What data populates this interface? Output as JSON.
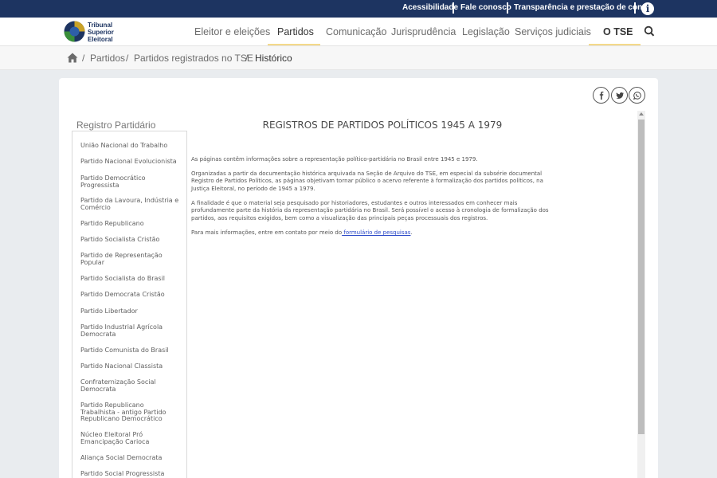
{
  "topbar": {
    "links": [
      "Acessibilidade",
      "Fale conosco",
      "Transparência e prestação de contas"
    ]
  },
  "logo": {
    "line1": "Tribunal",
    "line2": "Superior",
    "line3": "Eleitoral"
  },
  "nav": {
    "items": [
      "Eleitor e eleições",
      "Partidos",
      "Comunicação",
      "Jurisprudência",
      "Legislação",
      "Serviços judiciais",
      "O TSE"
    ],
    "active": "Partidos"
  },
  "breadcrumb": {
    "items": [
      "Partidos",
      "Partidos registrados no TSE"
    ],
    "current": "Histórico",
    "separator": "/"
  },
  "sidebar": {
    "title": "Registro Partidário",
    "items": [
      "União Nacional do Trabalho",
      "Partido Nacional Evolucionista",
      "Partido Democrático Progressista",
      "Partido da Lavoura, Indústria e Comércio",
      "Partido Republicano",
      "Partido Socialista Cristão",
      "Partido de Representação Popular",
      "Partido Socialista do Brasil",
      "Partido Democrata Cristão",
      "Partido Libertador",
      "Partido Industrial Agrícola Democrata",
      "Partido Comunista do Brasil",
      "Partido Nacional Classista",
      "Confraternização Social Democrata",
      "Partido Republicano Trabalhista - antigo Partido Republicano Democrático",
      "Núcleo Eleitoral Pró Emancipação Carioca",
      "Aliança Social Democrata",
      "Partido Social Progressista"
    ]
  },
  "main": {
    "title": "REGISTROS DE PARTIDOS POLÍTICOS 1945 A 1979",
    "paragraphs": [
      "As páginas contêm informações sobre a representação político-partidária no Brasil entre 1945 e 1979.",
      "Organizadas a partir da documentação histórica arquivada na Seção de Arquivo do TSE, em especial da subsérie documental Registro de Partidos Políticos, as páginas objetivam tornar público o acervo referente à formalização dos partidos políticos, na Justiça Eleitoral, no período de 1945 a 1979.",
      "A finalidade é que o material seja pesquisado por historiadores, estudantes e outros interessados em conhecer mais profundamente parte da história da representação partidária no Brasil. Será possível o acesso à cronologia de formalização dos partidos, aos requisitos exigidos, bem como a visualização das principais peças processuais dos registros."
    ],
    "contact_prefix": "Para mais informações, entre em contato por meio do",
    "contact_link": " formulário de pesquisas",
    "contact_suffix": "."
  },
  "share": {
    "icons": [
      "facebook-icon",
      "twitter-icon",
      "whatsapp-icon"
    ]
  },
  "colors": {
    "topbar": "#1d3461",
    "link": "#2b49c8",
    "nav_underline": "#f4d98a"
  }
}
